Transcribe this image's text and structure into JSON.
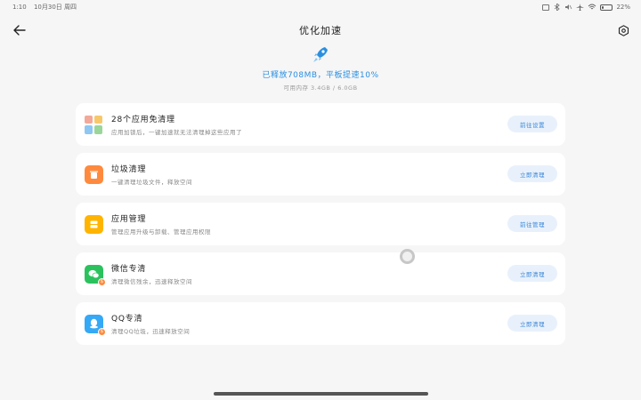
{
  "status": {
    "time": "1:10",
    "date": "10月30日 周四",
    "battery": "22%",
    "battery_level": 0.22
  },
  "header": {
    "title": "优化加速",
    "back_icon": "arrow-left-icon",
    "settings_icon": "gear-icon"
  },
  "summary": {
    "headline": "已释放708MB，平板提速10%",
    "memory": "可用内存 3.4GB / 6.0GB",
    "accent": "#2a8fe0"
  },
  "cards": [
    {
      "title": "28个应用免清理",
      "desc": "应用加锁后，一键加速就无法清理掉这些应用了",
      "action": "前往设置"
    },
    {
      "title": "垃圾清理",
      "desc": "一键清理垃圾文件，释放空间",
      "action": "立即清理",
      "icon_color": "#ff8a3d"
    },
    {
      "title": "应用管理",
      "desc": "管理应用升级与卸载、管理应用权限",
      "action": "前往管理",
      "icon_color": "#ffb400"
    },
    {
      "title": "微信专清",
      "desc": "清理微信残余，迅速释放空间",
      "action": "立即清理",
      "icon_color": "#2bc25e"
    },
    {
      "title": "QQ专清",
      "desc": "清理QQ垃圾，迅速释放空间",
      "action": "立即清理",
      "icon_color": "#35a9f5"
    }
  ]
}
